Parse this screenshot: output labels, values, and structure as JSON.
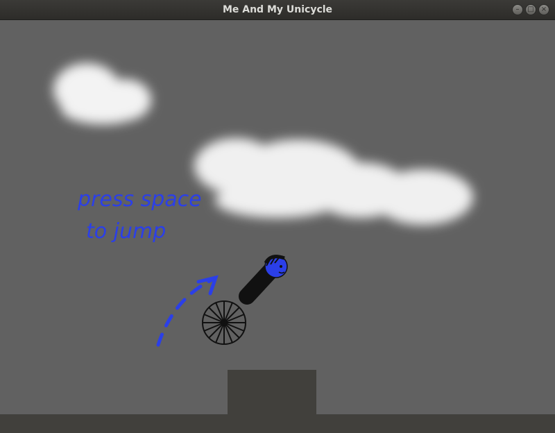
{
  "window": {
    "title": "Me And My Unicycle",
    "buttons": [
      {
        "name": "minimize",
        "glyph": "–"
      },
      {
        "name": "maximize",
        "glyph": "□"
      },
      {
        "name": "close",
        "glyph": "×"
      }
    ]
  },
  "hint": {
    "line1": "press space",
    "line2": "to jump"
  },
  "colors": {
    "sky": "#616161",
    "ground": "#41403c",
    "hint": "#2b3fe8",
    "rider_head": "#2b3fe8",
    "rider_body": "#111111",
    "cloud": "#f2f2f2"
  }
}
